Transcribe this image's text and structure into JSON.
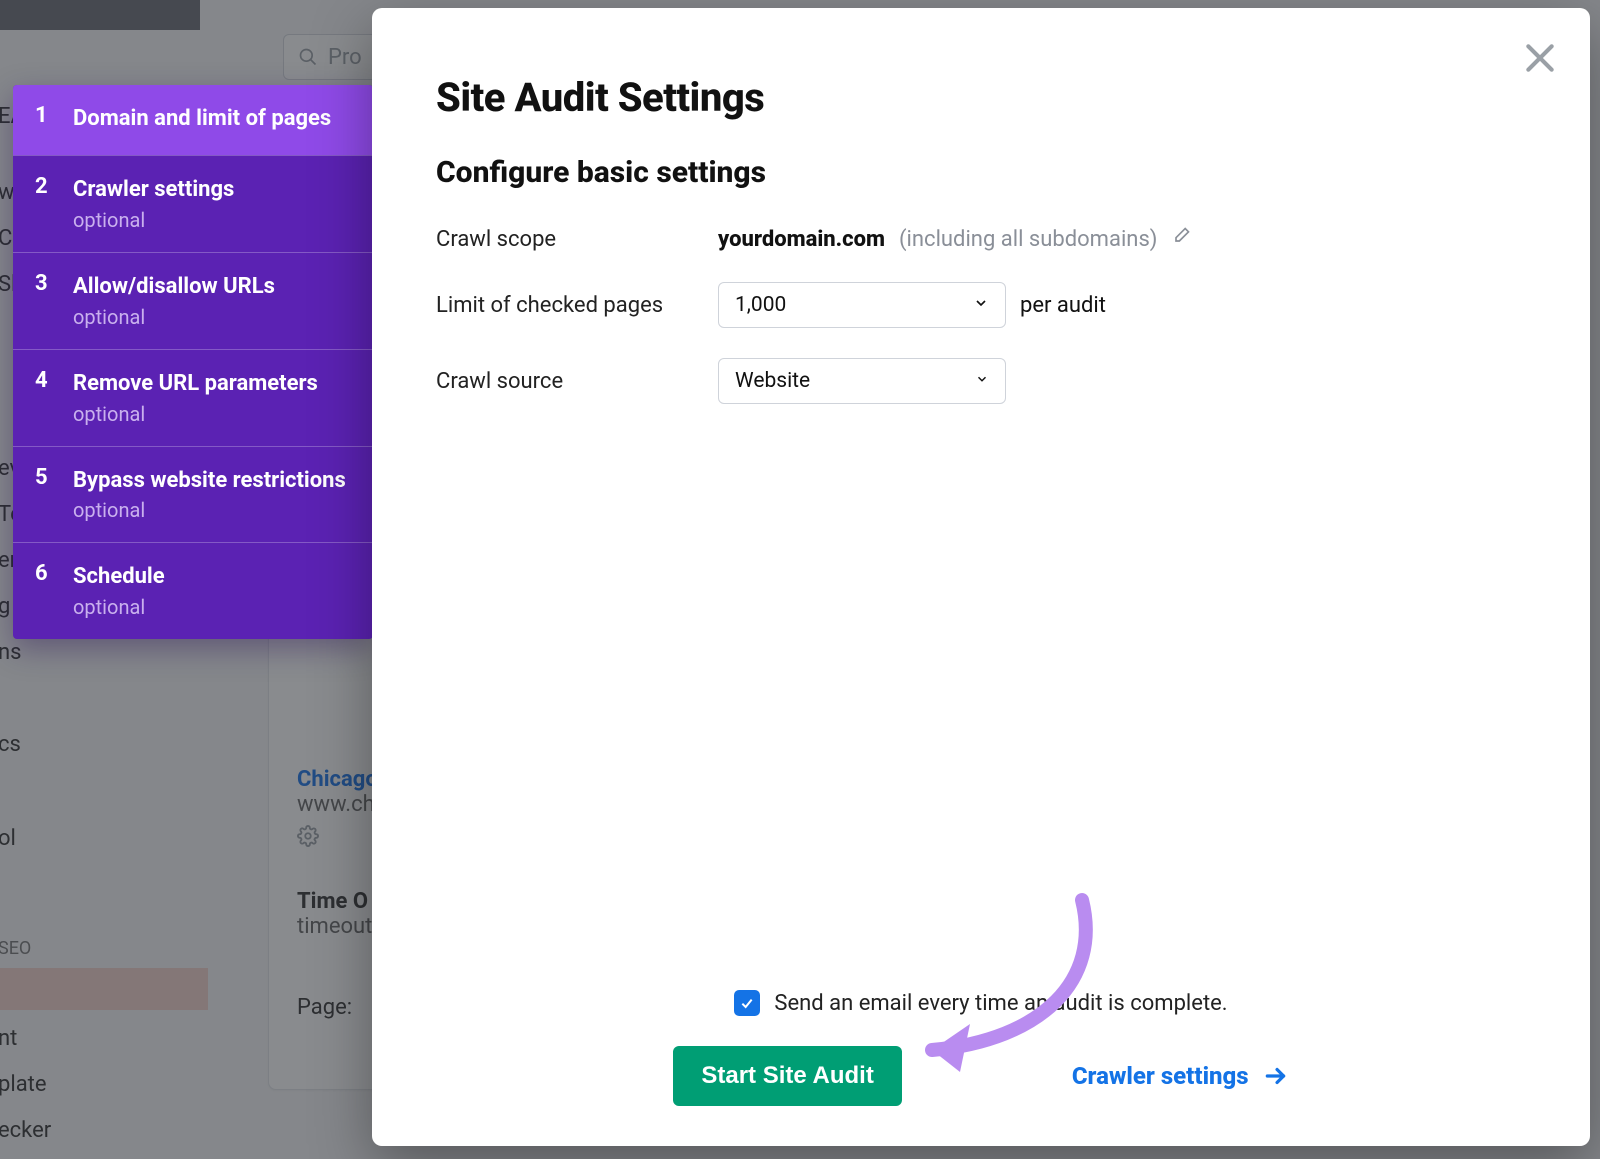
{
  "background": {
    "search_placeholder": "Pro",
    "link_text": "Chicago",
    "link_sub": "www.ch",
    "title2": "Time O",
    "title2_sub": "timeout",
    "page_label": "Page:",
    "side": [
      "EA",
      "w",
      "C",
      "Sh",
      "ev",
      "To",
      "er",
      "g",
      "ns",
      "cs",
      "ol",
      "SEO",
      "nt",
      "plate",
      "ecker"
    ]
  },
  "wizard": {
    "items": [
      {
        "num": "1",
        "title": "Domain and limit of pages",
        "optional": ""
      },
      {
        "num": "2",
        "title": "Crawler settings",
        "optional": "optional"
      },
      {
        "num": "3",
        "title": "Allow/disallow URLs",
        "optional": "optional"
      },
      {
        "num": "4",
        "title": "Remove URL parameters",
        "optional": "optional"
      },
      {
        "num": "5",
        "title": "Bypass website restrictions",
        "optional": "optional"
      },
      {
        "num": "6",
        "title": "Schedule",
        "optional": "optional"
      }
    ]
  },
  "modal": {
    "title": "Site Audit Settings",
    "subtitle": "Configure basic settings",
    "crawl_scope_label": "Crawl scope",
    "crawl_scope_domain": "yourdomain.com",
    "crawl_scope_hint": "(including all subdomains)",
    "limit_label": "Limit of checked pages",
    "limit_value": "1,000",
    "limit_suffix": "per audit",
    "source_label": "Crawl source",
    "source_value": "Website",
    "email_label": "Send an email every time an audit is complete.",
    "start_button": "Start Site Audit",
    "next_link": "Crawler settings"
  }
}
